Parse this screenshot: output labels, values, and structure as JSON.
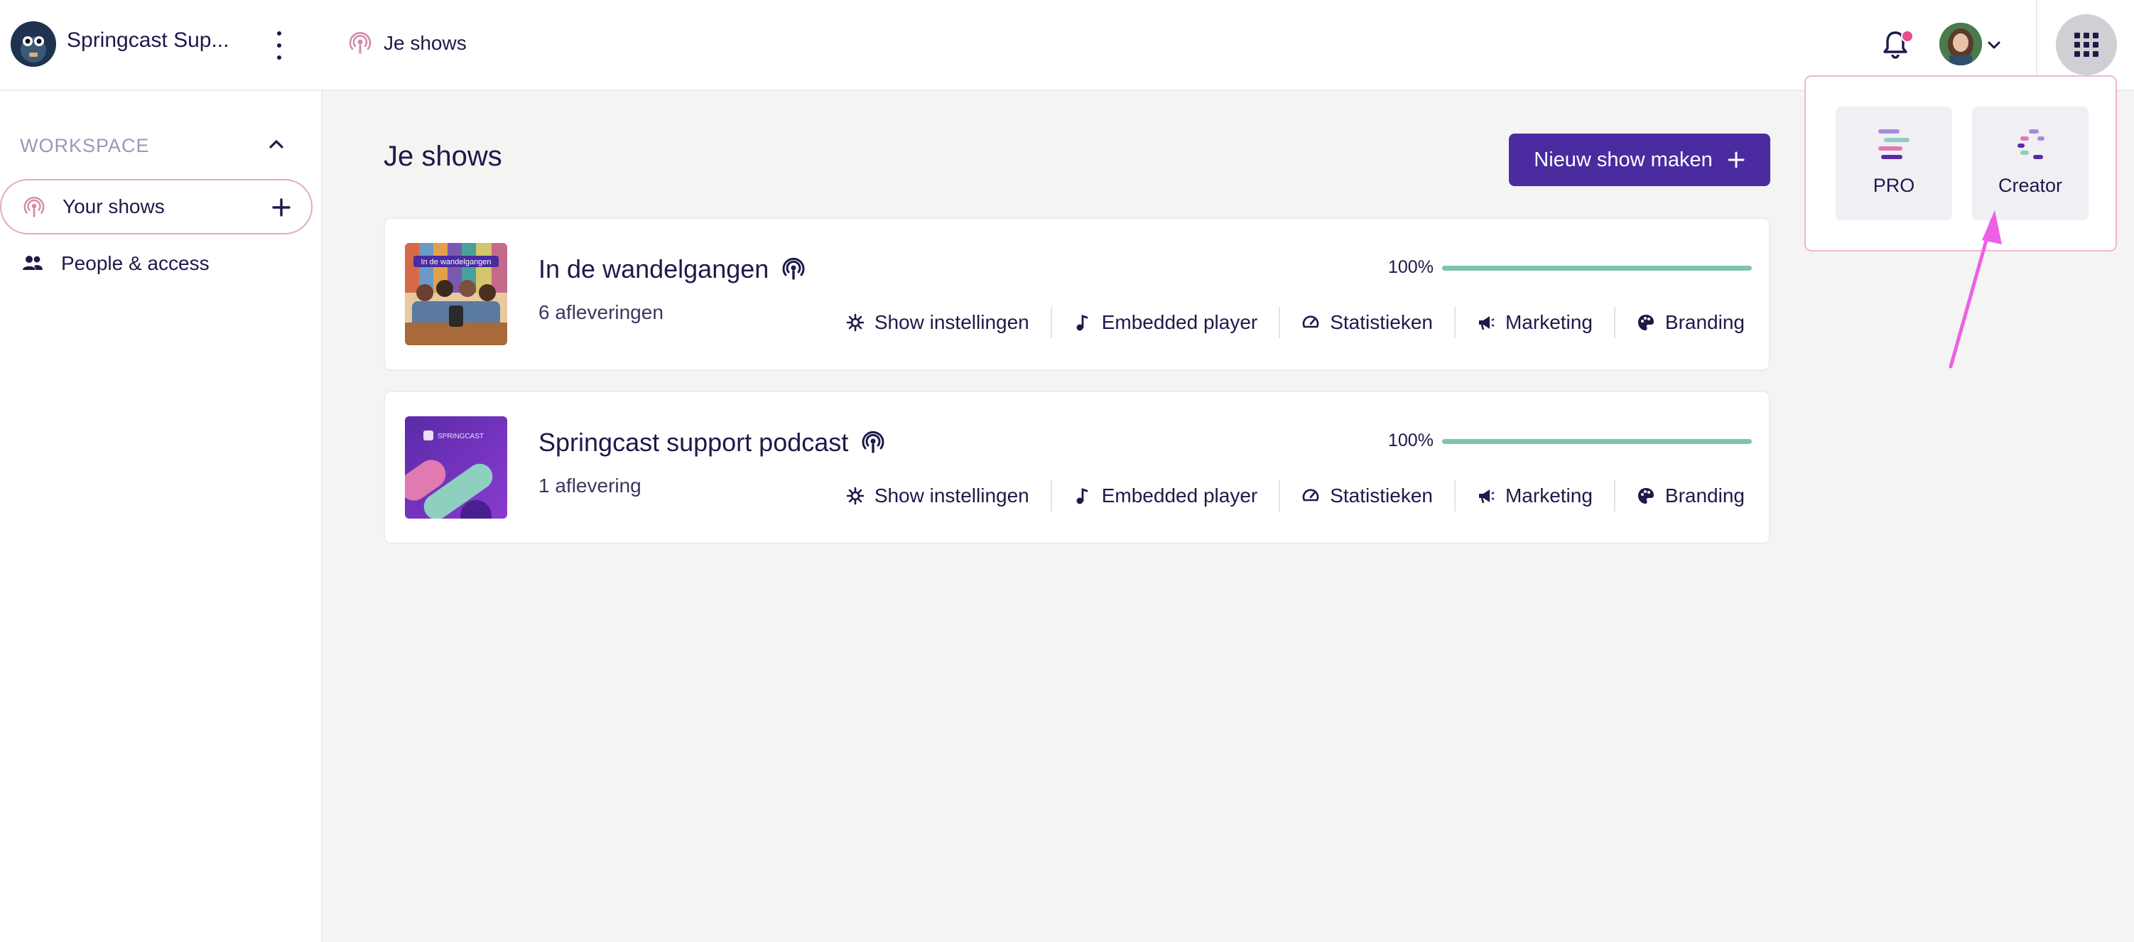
{
  "header": {
    "workspace_name": "Springcast Sup...",
    "breadcrumb": "Je shows"
  },
  "sidebar": {
    "section_label": "WORKSPACE",
    "items": [
      {
        "label": "Your shows"
      },
      {
        "label": "People & access"
      }
    ]
  },
  "main": {
    "title": "Je shows",
    "new_show_label": "Nieuw show maken",
    "shows": [
      {
        "title": "In de wandelgangen",
        "episodes": "6 afleveringen",
        "progress_label": "100%",
        "progress": 1.0,
        "thumb_caption": "In de wandelgangen"
      },
      {
        "title": "Springcast support podcast",
        "episodes": "1 aflevering",
        "progress_label": "100%",
        "progress": 1.0,
        "thumb_caption": "SPRINGCAST"
      }
    ],
    "actions": [
      "Show instellingen",
      "Embedded player",
      "Statistieken",
      "Marketing",
      "Branding"
    ]
  },
  "apps_menu": {
    "items": [
      {
        "label": "PRO"
      },
      {
        "label": "Creator"
      }
    ]
  },
  "colors": {
    "primary": "#4a2ba0",
    "progress": "#7ec4b2",
    "accent_pink": "#e84d8c",
    "annotation_arrow": "#ee5fe6"
  }
}
